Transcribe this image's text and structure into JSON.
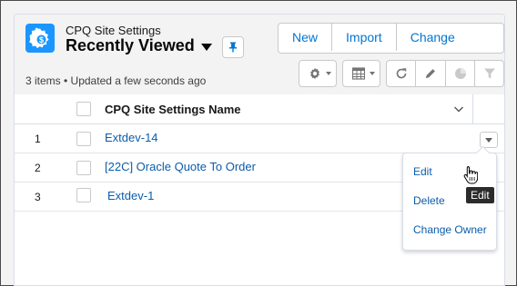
{
  "header": {
    "object_name": "CPQ Site Settings",
    "list_view_title": "Recently Viewed",
    "status": "3 items • Updated a few seconds ago",
    "object_icon": "settings-gear-dollar-icon",
    "pin_icon": "pin-icon"
  },
  "actions": {
    "new_label": "New",
    "import_label": "Import",
    "change_owner_label": "Change Owner"
  },
  "toolbar": {
    "icons": [
      "gear-icon",
      "table-icon",
      "refresh-icon",
      "edit-pencil-icon",
      "chart-icon",
      "filter-icon"
    ]
  },
  "table": {
    "column_header": "CPQ Site Settings Name",
    "rows": [
      {
        "num": "1",
        "name": "Extdev-14"
      },
      {
        "num": "2",
        "name": "[22C] Oracle Quote To Order"
      },
      {
        "num": "3",
        "name": "Extdev-1"
      }
    ]
  },
  "row_menu": {
    "items": [
      "Edit",
      "Delete",
      "Change Owner"
    ]
  },
  "tooltip": "Edit",
  "colors": {
    "brand_blue": "#0176d3",
    "link_blue": "#0b5cab",
    "icon_blue": "#1b96ff"
  }
}
